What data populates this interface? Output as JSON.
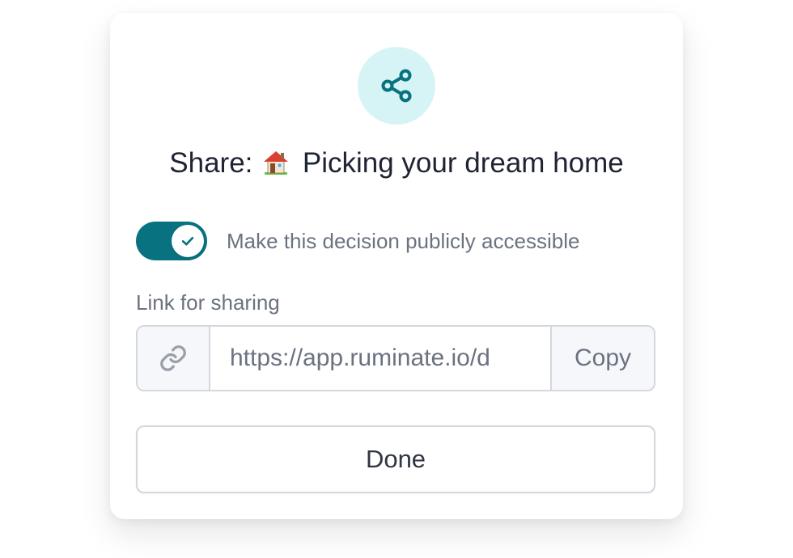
{
  "dialog": {
    "icon": "share-icon",
    "title_prefix": "Share:",
    "title_emoji": "house-icon",
    "title_text": "Picking your dream home"
  },
  "public_toggle": {
    "on": true,
    "label": "Make this decision publicly accessible"
  },
  "share_link": {
    "label": "Link for sharing",
    "icon": "link-icon",
    "value": "https://app.ruminate.io/d",
    "copy_label": "Copy"
  },
  "done_button": {
    "label": "Done"
  },
  "colors": {
    "accent": "#087281",
    "icon_bg": "#d6f4f5",
    "title_text": "#1f2433",
    "muted_text": "#6b7280",
    "border": "#d4d7de"
  }
}
